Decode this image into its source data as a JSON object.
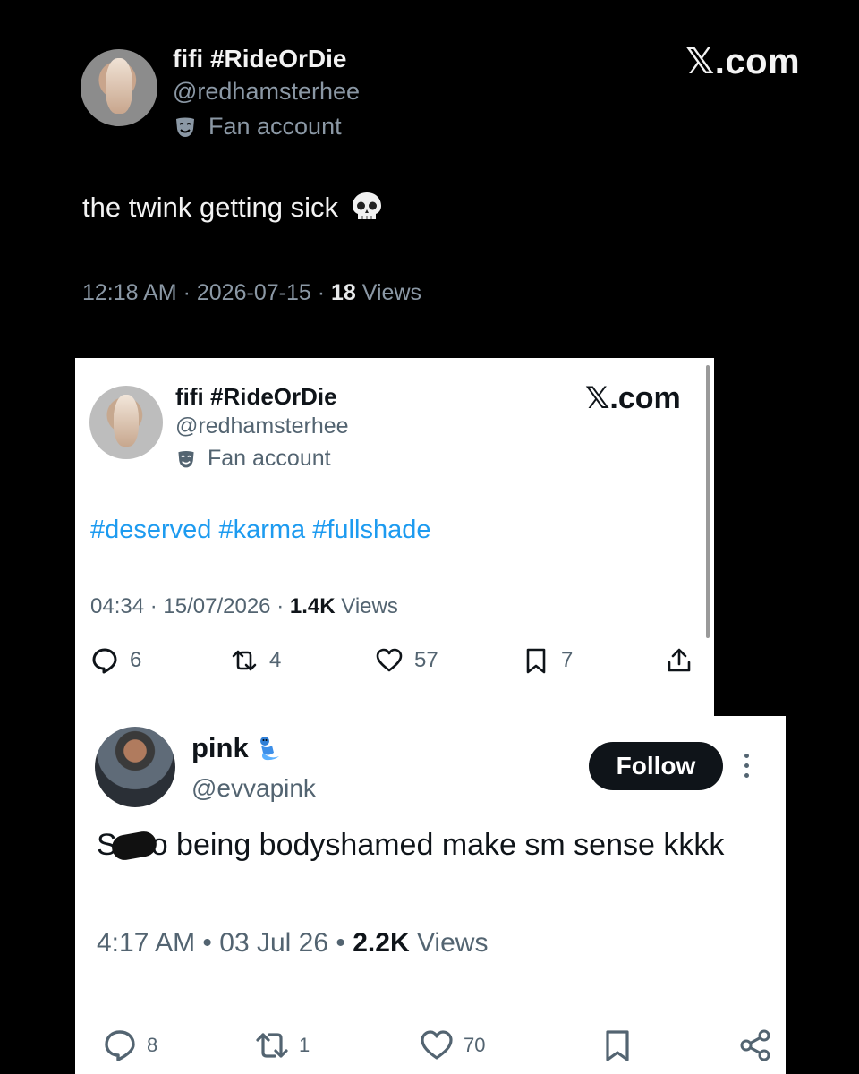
{
  "tweet1": {
    "display_name": "fifi #RideOrDie",
    "handle": "@redhamsterhee",
    "badge_label": "Fan account",
    "site_label": "𝕏.com",
    "text": "the twink getting sick",
    "time": "12:18 AM",
    "sep1": "·",
    "date": "2026-07-15",
    "sep2": "·",
    "views_count": "18",
    "views_label": "Views"
  },
  "tweet2": {
    "display_name": "fifi #RideOrDie",
    "handle": "@redhamsterhee",
    "badge_label": "Fan account",
    "site_label": "𝕏.com",
    "hashtags": "#deserved #karma #fullshade",
    "time": "04:34",
    "sep1": "·",
    "date": "15/07/2026",
    "sep2": "·",
    "views_count": "1.4K",
    "views_label": "Views",
    "actions": {
      "replies": "6",
      "reposts": "4",
      "likes": "57",
      "bookmarks": "7"
    },
    "colors": {
      "hashtag": "#1d9bf0"
    }
  },
  "tweet3": {
    "display_name": "pink",
    "handle": "@evvapink",
    "follow_label": "Follow",
    "text_start": "S",
    "text_rest": "o being bodyshamed make sm sense kkkk",
    "time": "4:17 AM",
    "sep1": "•",
    "date": "03 Jul 26",
    "sep2": "•",
    "views_count": "2.2K",
    "views_label": "Views",
    "actions": {
      "replies": "8",
      "reposts": "1",
      "likes": "70"
    }
  }
}
